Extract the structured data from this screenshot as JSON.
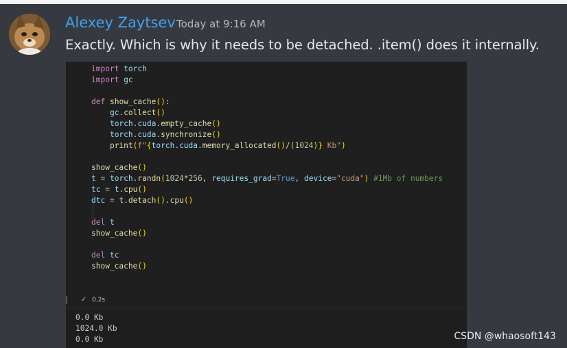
{
  "message": {
    "username": "Alexey Zaytsev",
    "timestamp": "Today at 9:16 AM",
    "text": "Exactly. Which is why it needs to be detached. .item() does it internally.",
    "avatar_icon": "cat-avatar"
  },
  "code_cell": {
    "lines": [
      "import torch",
      "import gc",
      "",
      "def show_cache():",
      "    gc.collect()",
      "    torch.cuda.empty_cache()",
      "    torch.cuda.synchronize()",
      "    print(f\"{torch.cuda.memory_allocated()/(1024)} Kb\")",
      "",
      "show_cache()",
      "t = torch.randn(1024*256, requires_grad=True, device=\"cuda\") #1Mb of numbers",
      "tc = t.cpu()",
      "dtc = t.detach().cpu()",
      "",
      "del t",
      "show_cache()",
      "",
      "del tc",
      "show_cache()"
    ],
    "status_icon": "check-icon",
    "duration": "0.2s",
    "output": [
      "0.0 Kb",
      "1024.0 Kb",
      "0.0 Kb"
    ]
  },
  "watermark": "CSDN @whaosoft143",
  "colors": {
    "background": "#36393f",
    "username": "#3ea2f0",
    "code_background": "#1f1f1f"
  }
}
